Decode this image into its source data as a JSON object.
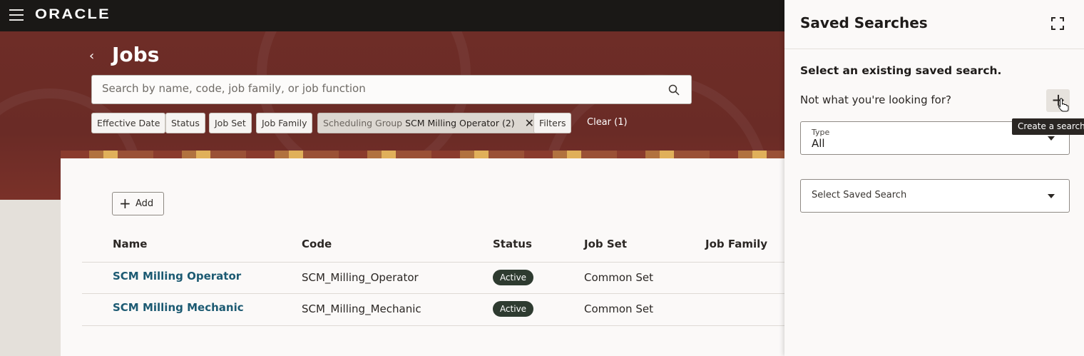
{
  "app": {
    "logo": "ORACLE"
  },
  "page": {
    "title": "Jobs"
  },
  "search": {
    "placeholder": "Search by name, code, job family, or job function"
  },
  "filters": {
    "chips": [
      "Effective Date",
      "Status",
      "Job Set",
      "Job Family"
    ],
    "active": {
      "label": "Scheduling Group",
      "value": "SCM Milling Operator (2)"
    },
    "more": "Filters",
    "clear": "Clear (1)"
  },
  "toolbar": {
    "add_label": "Add"
  },
  "table": {
    "headers": [
      "Name",
      "Code",
      "Status",
      "Job Set",
      "Job Family"
    ],
    "rows": [
      {
        "name": "SCM Milling Operator",
        "code": "SCM_Milling_Operator",
        "status": "Active",
        "job_set": "Common Set"
      },
      {
        "name": "SCM Milling Mechanic",
        "code": "SCM_Milling_Mechanic",
        "status": "Active",
        "job_set": "Common Set"
      }
    ]
  },
  "drawer": {
    "title": "Saved Searches",
    "subtitle": "Select an existing saved search.",
    "question": "Not what you're looking for?",
    "tooltip": "Create a search",
    "type_label": "Type",
    "type_value": "All",
    "saved_search_placeholder": "Select Saved Search"
  },
  "colors": {
    "accent": "#6e2d27",
    "link": "#1c5a72",
    "badge": "#2e3b30"
  }
}
